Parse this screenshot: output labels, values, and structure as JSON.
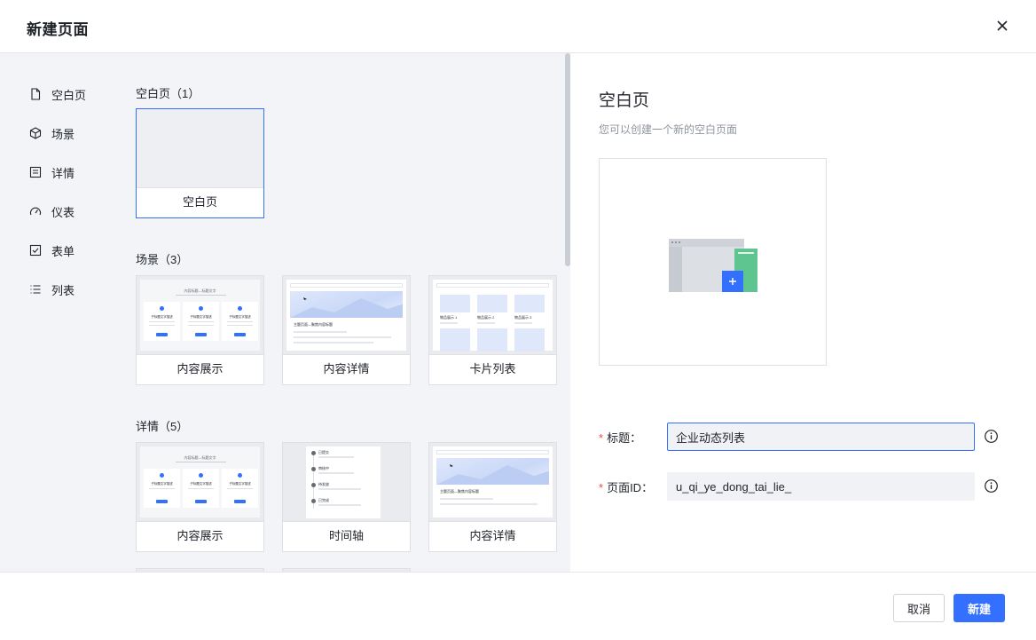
{
  "dialog": {
    "title": "新建页面"
  },
  "nav": {
    "items": [
      {
        "label": "空白页",
        "icon": "file-icon"
      },
      {
        "label": "场景",
        "icon": "cube-icon"
      },
      {
        "label": "详情",
        "icon": "detail-icon"
      },
      {
        "label": "仪表",
        "icon": "gauge-icon"
      },
      {
        "label": "表单",
        "icon": "checkbox-icon"
      },
      {
        "label": "列表",
        "icon": "list-icon"
      }
    ]
  },
  "sections": {
    "blank": {
      "title": "空白页（1）",
      "cards": [
        "空白页"
      ]
    },
    "scene": {
      "title": "场景（3）",
      "cards": [
        "内容展示",
        "内容详情",
        "卡片列表"
      ]
    },
    "detail": {
      "title": "详情（5）",
      "cards": [
        "内容展示",
        "时间轴",
        "内容详情"
      ]
    }
  },
  "thumb_text": {
    "showcase_title": "内容标题—标题文字",
    "showcase_item": "子标题文字描述",
    "detail_caption": "主题页面—聚焦内容标题",
    "card_item_1": "物品展示 1",
    "card_item_2": "物品展示 2",
    "card_item_3": "物品展示 3",
    "timeline_1": "已提交",
    "timeline_2": "审核中",
    "timeline_3": "待发放",
    "timeline_4": "已完成"
  },
  "preview": {
    "title": "空白页",
    "description": "您可以创建一个新的空白页面"
  },
  "form": {
    "title_label": "标题：",
    "title_value": "企业动态列表",
    "page_id_label": "页面ID：",
    "page_id_value": "u_qi_ye_dong_tai_lie_"
  },
  "footer": {
    "cancel_label": "取消",
    "create_label": "新建"
  },
  "colors": {
    "primary": "#3370ff",
    "required": "#f54a45",
    "panel_bg": "#f3f4f7",
    "preview_green": "#5ec490"
  }
}
